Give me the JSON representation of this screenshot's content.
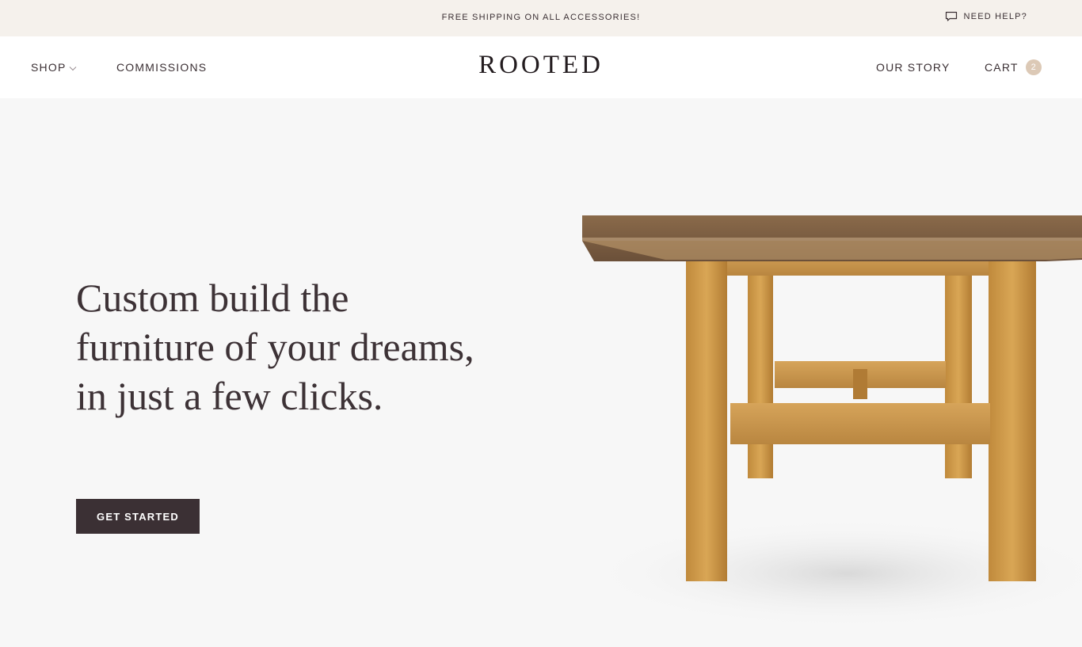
{
  "announcement": {
    "text": "FREE SHIPPING ON ALL ACCESSORIES!",
    "help_label": "NEED HELP?"
  },
  "nav": {
    "shop_label": "SHOP",
    "commissions_label": "COMMISSIONS",
    "logo": "ROOTED",
    "our_story_label": "OUR STORY",
    "cart_label": "CART",
    "cart_count": "2"
  },
  "hero": {
    "headline": "Custom build the furniture of your dreams, in just a few clicks.",
    "cta_label": "GET STARTED"
  },
  "icons": {
    "help": "chat-bubble-icon",
    "shop_dropdown": "chevron-down-icon"
  },
  "colors": {
    "announce_bg": "#f5f1ec",
    "text": "#3b3034",
    "cta_bg": "#3b3034",
    "badge": "#dcc9b6",
    "hero_bg": "#f7f7f7"
  }
}
